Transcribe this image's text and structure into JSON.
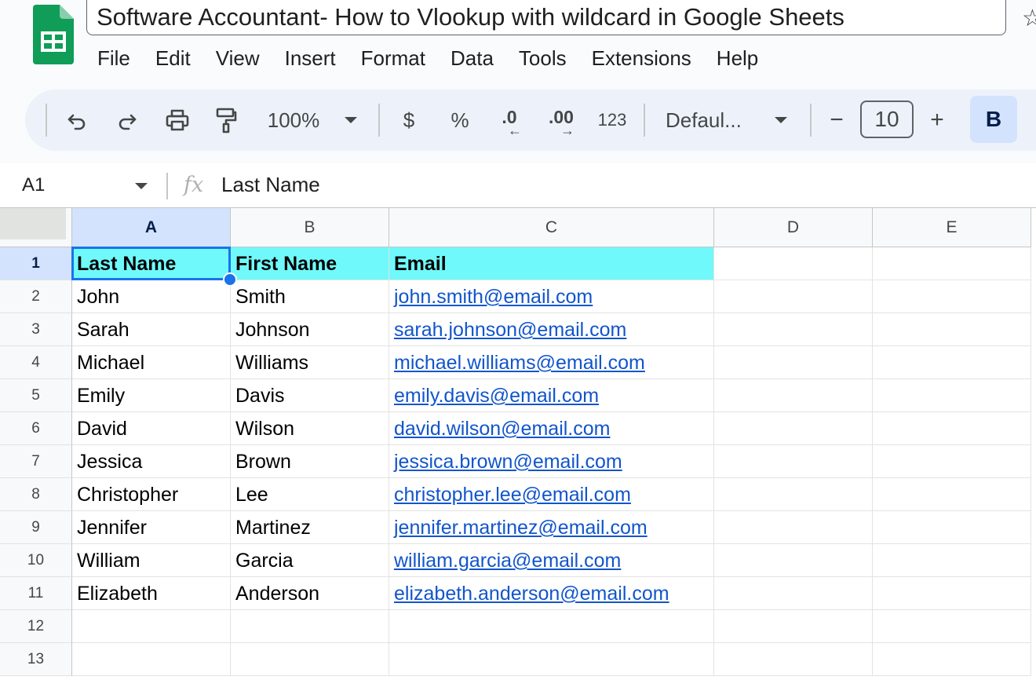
{
  "app": {
    "title": "Software Accountant- How to Vlookup with wildcard in Google Sheets",
    "menu": [
      "File",
      "Edit",
      "View",
      "Insert",
      "Format",
      "Data",
      "Tools",
      "Extensions",
      "Help"
    ]
  },
  "toolbar": {
    "zoom": "100%",
    "currency": "$",
    "percent": "%",
    "decrease_decimal": ".0",
    "increase_decimal": ".00",
    "number_format": "123",
    "font": "Defaul...",
    "font_size": "10",
    "decrease_size": "−",
    "increase_size": "+",
    "bold": "B"
  },
  "formula_bar": {
    "cell_ref": "A1",
    "fx": "fx",
    "content": "Last Name"
  },
  "sheet": {
    "columns": [
      "A",
      "B",
      "C",
      "D",
      "E"
    ],
    "row_numbers": [
      "1",
      "2",
      "3",
      "4",
      "5",
      "6",
      "7",
      "8",
      "9",
      "10",
      "11",
      "12",
      "13"
    ],
    "selected_cell": "A1",
    "rows": [
      [
        "Last Name",
        "First Name",
        "Email"
      ],
      [
        "John",
        "Smith",
        "john.smith@email.com"
      ],
      [
        "Sarah",
        "Johnson",
        "sarah.johnson@email.com"
      ],
      [
        "Michael",
        "Williams",
        "michael.williams@email.com"
      ],
      [
        "Emily",
        "Davis",
        "emily.davis@email.com"
      ],
      [
        "David",
        "Wilson",
        "david.wilson@email.com"
      ],
      [
        "Jessica",
        "Brown",
        "jessica.brown@email.com"
      ],
      [
        "Christopher",
        "Lee",
        "christopher.lee@email.com"
      ],
      [
        "Jennifer",
        "Martinez",
        "jennifer.martinez@email.com"
      ],
      [
        "William",
        "Garcia",
        "william.garcia@email.com"
      ],
      [
        "Elizabeth",
        "Anderson",
        "elizabeth.anderson@email.com"
      ]
    ]
  },
  "colors": {
    "header_fill": "#70f9fa",
    "link": "#1155cc",
    "selection": "#1a73e8",
    "logo_green": "#0f9d58"
  }
}
